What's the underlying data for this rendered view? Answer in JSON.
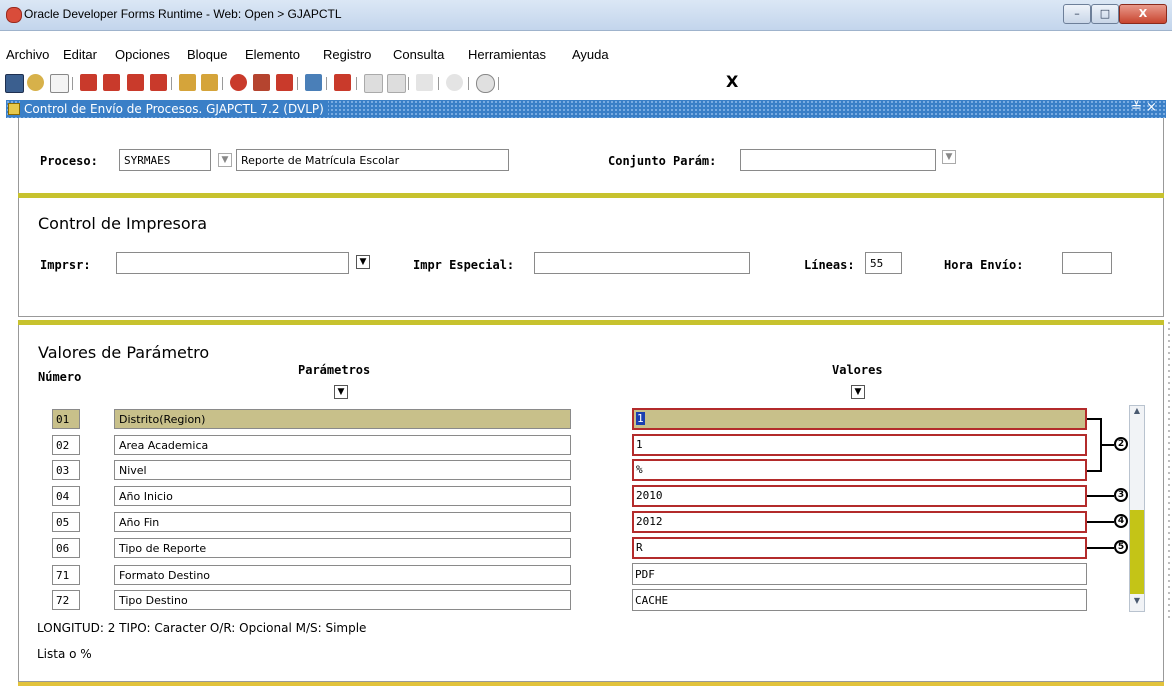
{
  "window": {
    "title": "Oracle Developer Forms Runtime - Web:  Open > GJAPCTL",
    "minimize": "–",
    "maximize": "□",
    "close": "X"
  },
  "menu": [
    "Archivo",
    "Editar",
    "Opciones",
    "Bloque",
    "Elemento",
    "Registro",
    "Consulta",
    "Herramientas",
    "Ayuda"
  ],
  "toolbar": {
    "icons": [
      "save-icon",
      "rollback-icon",
      "page-icon",
      "insert-record-icon",
      "remove-record-icon",
      "enter-query-icon",
      "execute-query-icon",
      "previous-block-icon",
      "next-block-icon",
      "help-icon",
      "database-icon",
      "cancel-icon",
      "print-icon",
      "print-setup-icon",
      "item-icon",
      "block-icon",
      "sound-icon",
      "options-icon",
      "exit-help-icon"
    ],
    "exit_label": "X"
  },
  "form": {
    "title": "Control de Envío de Procesos.  GJAPCTL  7.2  (DVLP)",
    "controls": "≚ ×"
  },
  "proceso": {
    "label": "Proceso:",
    "code": "SYRMAES",
    "description": "Reporte de Matrícula Escolar",
    "conjunto_label": "Conjunto Parám:",
    "conjunto_value": ""
  },
  "printer": {
    "heading": "Control de Impresora",
    "imprsr_label": "Imprsr:",
    "imprsr_value": "",
    "especial_label": "Impr Especial:",
    "especial_value": "",
    "lineas_label": "Líneas:",
    "lineas_value": "55",
    "hora_label": "Hora Envío:",
    "hora_value": ""
  },
  "params": {
    "heading": "Valores de Parámetro",
    "numero_header": "Número",
    "parametros_header": "Parámetros",
    "valores_header": "Valores",
    "rows": [
      {
        "num": "01",
        "name": "Distrito(Region)",
        "value": "1"
      },
      {
        "num": "02",
        "name": "Area Academica",
        "value": "1"
      },
      {
        "num": "03",
        "name": "Nivel",
        "value": "%"
      },
      {
        "num": "04",
        "name": "Año Inicio",
        "value": "2010"
      },
      {
        "num": "05",
        "name": "Año Fin",
        "value": "2012"
      },
      {
        "num": "06",
        "name": "Tipo de Reporte",
        "value": "R"
      },
      {
        "num": "71",
        "name": "Formato Destino",
        "value": "PDF"
      },
      {
        "num": "72",
        "name": "Tipo Destino",
        "value": "CACHE"
      }
    ],
    "callouts": [
      "2",
      "3",
      "4",
      "5"
    ],
    "hint1": "LONGITUD: 2 TIPO: Caracter O/R: Opcional M/S: Simple",
    "hint2": "Lista o %"
  },
  "colors": {
    "panel_accent": "#c7c22e",
    "form_bar": "#3a7fc7",
    "selected_row": "#c8c08a",
    "highlight_border": "#b32b2b"
  }
}
